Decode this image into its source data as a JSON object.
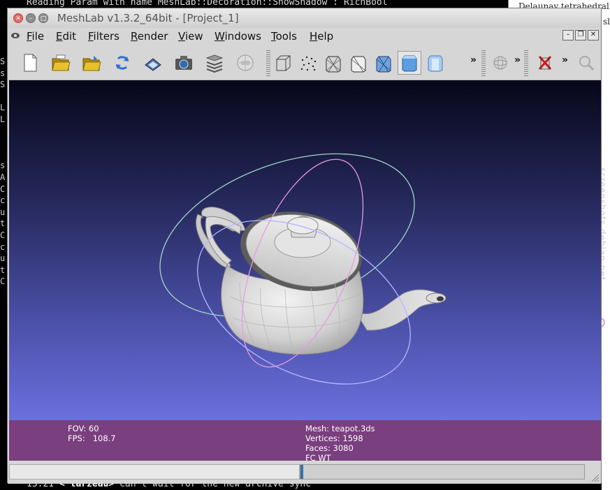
{
  "background": {
    "terminal_top_text": "Reading Param with name MeshLab::Decoration::ShowShadow : RichBool",
    "terminal_bottom_time": "13:21",
    "terminal_bottom_nick": "< tarzeau>",
    "terminal_bottom_msg": " can't wait for the new archive sync",
    "terminal_left_chars": [
      "S",
      "s",
      "S",
      "",
      "L",
      "L",
      "",
      "",
      "",
      "s",
      "A",
      "C",
      "c",
      "u",
      "t",
      "C",
      "c",
      "u",
      "t",
      "C"
    ],
    "right_doc_text": "Delaunay tetrahedral",
    "right_doc_text2": "sl",
    "watermark": "screenshots.debian.net"
  },
  "window": {
    "title": "MeshLab v1.3.2_64bit - [Project_1]"
  },
  "menu": {
    "items": [
      "File",
      "Edit",
      "Filters",
      "Render",
      "View",
      "Windows",
      "Tools",
      "Help"
    ]
  },
  "toolbar": {
    "overflow_label": "»"
  },
  "info": {
    "fov_label": "FOV: 60",
    "fps_label": "FPS:   108.7",
    "mesh_label": "Mesh: teapot.3ds",
    "vertices_label": "Vertices: 1598",
    "faces_label": "Faces: 3080",
    "mode_label": "FC WT"
  },
  "status": {
    "progress": 0.01
  },
  "colors": {
    "info_bar": "#7a3f7e",
    "viewport_top": "#07071a",
    "viewport_bottom": "#6b70de",
    "trackball_green": "#9fd6c6",
    "trackball_pink": "#e79be0",
    "trackball_blue": "#b4b8ff"
  }
}
